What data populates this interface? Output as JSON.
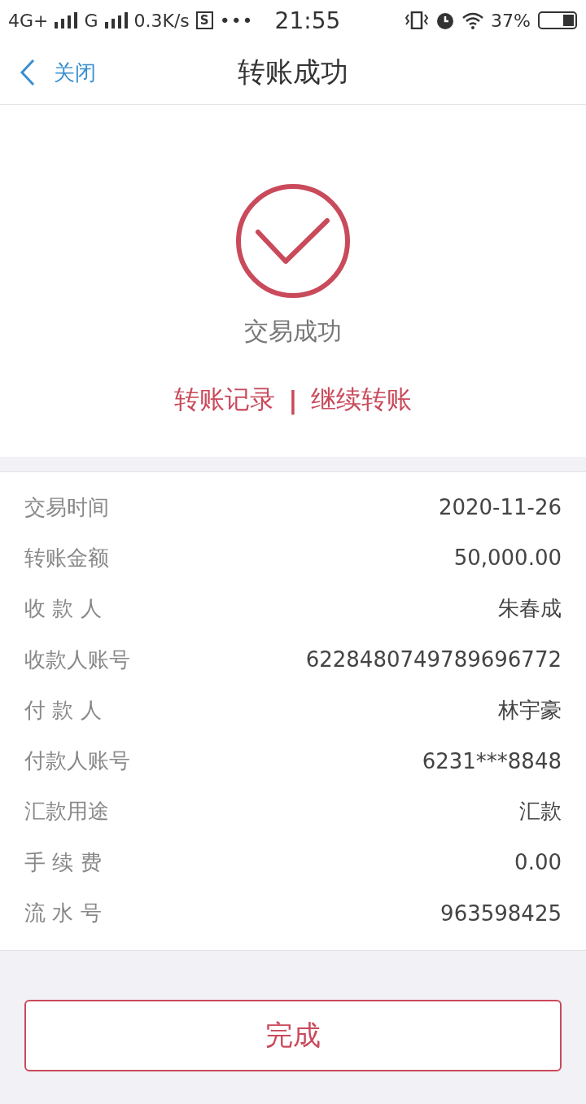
{
  "status_bar": {
    "network_1": "4G+",
    "network_2": "G",
    "speed": "0.3K/s",
    "app_badge": "S",
    "more": "•••",
    "time": "21:55",
    "battery": "37%"
  },
  "nav": {
    "back_label": "关闭",
    "title": "转账成功"
  },
  "result": {
    "message": "交易成功",
    "links": [
      "转账记录",
      "继续转账"
    ],
    "separator": "|"
  },
  "details": [
    {
      "label": "交易时间",
      "value": "2020-11-26"
    },
    {
      "label": "转账金额",
      "value": "50,000.00"
    },
    {
      "label": "收 款 人",
      "value": "朱春成"
    },
    {
      "label": "收款人账号",
      "value": "6228480749789696772"
    },
    {
      "label": "付 款 人",
      "value": "林宇豪"
    },
    {
      "label": "付款人账号",
      "value": "6231***8848"
    },
    {
      "label": "汇款用途",
      "value": "汇款"
    },
    {
      "label": "手 续 费",
      "value": "0.00"
    },
    {
      "label": "流 水 号",
      "value": "963598425"
    }
  ],
  "done_button": "完成"
}
